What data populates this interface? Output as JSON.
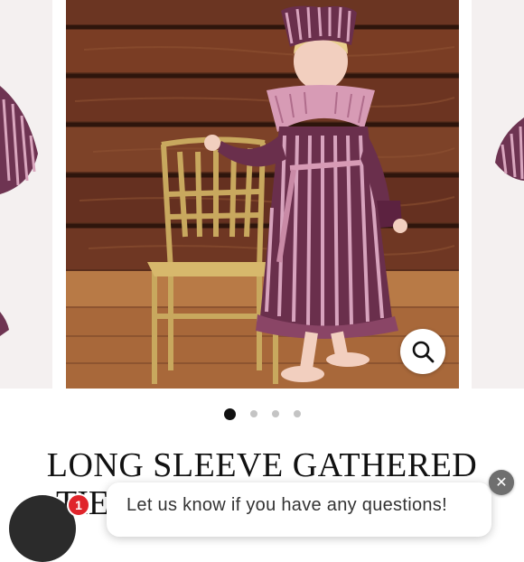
{
  "product": {
    "title_line1": "LONG SLEEVE GATHERED",
    "title_line2": "TIE"
  },
  "carousel": {
    "image_count": 4,
    "active_index": 0
  },
  "icons": {
    "zoom": "magnifier-icon",
    "chat_close": "close-icon"
  },
  "chat": {
    "prompt": "Let us know if you have any questions!",
    "badge_count": "1",
    "close_glyph": "✕"
  },
  "colors": {
    "text": "#111111",
    "dot_active": "#111111",
    "dot_inactive": "#c4c4c4",
    "badge": "#e0242b",
    "launcher": "#2b2b2b"
  }
}
